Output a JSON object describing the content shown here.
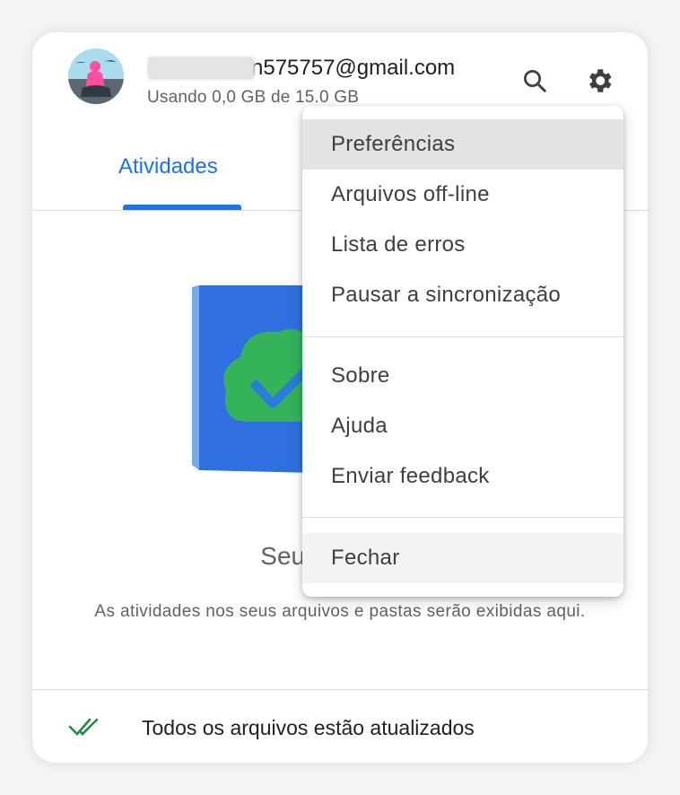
{
  "account": {
    "email_visible": "n575757@gmail.com",
    "storage": "Usando 0,0 GB de 15.0 GB"
  },
  "toolbar": {
    "search_icon": "search-icon",
    "settings_icon": "gear-icon"
  },
  "tabs": [
    {
      "label": "Atividades",
      "active": true
    }
  ],
  "empty_state": {
    "title": "Seus arquivos",
    "description": "As atividades nos seus arquivos e pastas serão exibidas aqui."
  },
  "status": {
    "text": "Todos os arquivos estão atualizados",
    "icon": "double-check-icon"
  },
  "menu": {
    "group1": [
      "Preferências",
      "Arquivos off-line",
      "Lista de erros",
      "Pausar a sincronização"
    ],
    "group2": [
      "Sobre",
      "Ajuda",
      "Enviar feedback"
    ],
    "group3": [
      "Fechar"
    ]
  },
  "colors": {
    "accent": "#1a73e8",
    "check_green": "#1e8e3e"
  }
}
